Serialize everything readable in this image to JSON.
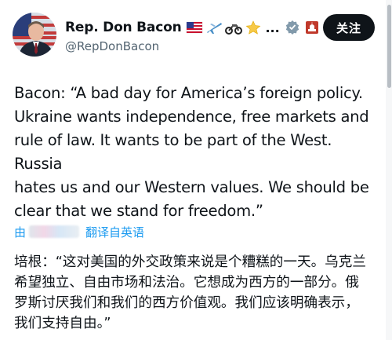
{
  "profile": {
    "display_name": "Rep. Don Bacon",
    "handle": "@RepDonBacon",
    "badges": [
      "us-flag-icon",
      "airplane-icon",
      "motorcycle-icon",
      "star-icon"
    ],
    "ellipsis": "...",
    "verification": "gray-verified-badge-icon",
    "affiliation": "us-capitol-icon"
  },
  "follow_button": {
    "label": "关注"
  },
  "tweet": {
    "text": "Bacon: “A bad day for America’s foreign policy.\nUkraine wants independence, free markets and\nrule of law. It wants to be part of the West. Russia\nhates us and our Western values. We should be\nclear that we stand for freedom.”"
  },
  "translation": {
    "prefix": "由",
    "label": "翻译自英语",
    "text": "培根：“这对美国的外交政策来说是个糟糕的一天。乌克兰\n希望独立、自由市场和法治。它想成为西方的一部分。俄\n罗斯讨厌我们和我们的西方价值观。我们应该明确表示，\n我们支持自由。”"
  },
  "colors": {
    "text": "#0f1419",
    "secondary": "#536471",
    "link": "#1d9bf0",
    "button": "#0f1419"
  }
}
